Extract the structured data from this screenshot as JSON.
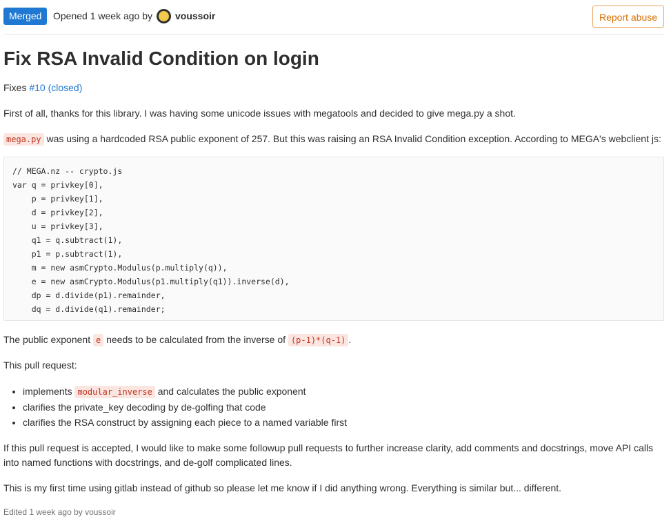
{
  "header": {
    "status": "Merged",
    "opened_text": "Opened 1 week ago by",
    "author": "voussoir",
    "report_label": "Report abuse"
  },
  "title": "Fix RSA Invalid Condition on login",
  "fixes": {
    "prefix": "Fixes",
    "link": "#10 (closed)"
  },
  "paragraphs": {
    "intro": "First of all, thanks for this library. I was having some unicode issues with megatools and decided to give mega.py a shot.",
    "exponent_code": "mega.py",
    "exponent_text": " was using a hardcoded RSA public exponent of 257. But this was raising an RSA Invalid Condition exception. According to MEGA's webclient js:",
    "public_a": "The public exponent ",
    "public_code1": "e",
    "public_b": " needs to be calculated from the inverse of ",
    "public_code2": "(p-1)*(q-1)",
    "public_c": ".",
    "this_pr": "This pull request:",
    "followup": "If this pull request is accepted, I would like to make some followup pull requests to further increase clarity, add comments and docstrings, move API calls into named functions with docstrings, and de-golf complicated lines.",
    "first_time": "This is my first time using gitlab instead of github so please let me know if I did anything wrong. Everything is similar but... different."
  },
  "code_block": "// MEGA.nz -- crypto.js\nvar q = privkey[0],\n    p = privkey[1],\n    d = privkey[2],\n    u = privkey[3],\n    q1 = q.subtract(1),\n    p1 = p.subtract(1),\n    m = new asmCrypto.Modulus(p.multiply(q)),\n    e = new asmCrypto.Modulus(p1.multiply(q1)).inverse(d),\n    dp = d.divide(p1).remainder,\n    dq = d.divide(q1).remainder;",
  "list": {
    "item1_a": "implements ",
    "item1_code": "modular_inverse",
    "item1_b": " and calculates the public exponent",
    "item2": "clarifies the private_key decoding by de-golfing that code",
    "item3": "clarifies the RSA construct by assigning each piece to a named variable first"
  },
  "edited": "Edited 1 week ago by voussoir",
  "colors": {
    "merged_badge": "#1f78d1",
    "report_border": "#e9a25a",
    "link": "#1f78d1",
    "inline_code_bg": "#fbe5e1",
    "inline_code_fg": "#c0341d"
  }
}
